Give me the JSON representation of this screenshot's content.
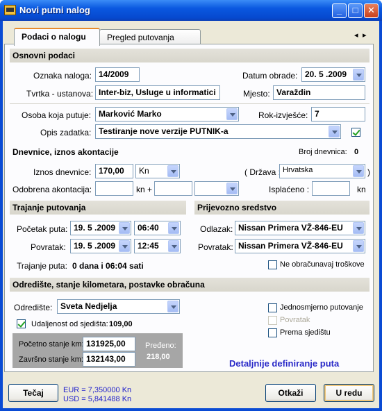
{
  "window": {
    "title": "Novi putni nalog"
  },
  "tabs": [
    {
      "label": "Podaci o nalogu"
    },
    {
      "label": "Pregled putovanja"
    }
  ],
  "tab_scroll": {
    "left": "◂",
    "right": "▸"
  },
  "osnovni": {
    "section": "Osnovni podaci",
    "oznaka_label": "Oznaka naloga:",
    "oznaka_value": "14/2009",
    "datum_label": "Datum obrade:",
    "datum_value": "20. 5 .2009",
    "tvrtka_label": "Tvrtka - ustanova:",
    "tvrtka_value": "Inter-biz, Usluge u informatici",
    "mjesto_label": "Mjesto:",
    "mjesto_value": "Varaždin",
    "osoba_label": "Osoba koja putuje:",
    "osoba_value": "Marković Marko",
    "rok_label": "Rok-izvješće:",
    "rok_value": "7",
    "opis_label": "Opis zadatka:",
    "opis_value": "Testiranje nove verzije PUTNIK-a",
    "opis_checked": true
  },
  "dnevnice": {
    "section": "Dnevnice, iznos akontacije",
    "broj_label": "Broj dnevnica:",
    "broj_value": "0",
    "iznos_label": "Iznos dnevnice:",
    "iznos_value": "170,00",
    "iznos_currency": "Kn",
    "drzava_label": "( Država :",
    "drzava_value": "Hrvatska",
    "drzava_close": ")",
    "akontacija_label": "Odobrena akontacija:",
    "akontacija_value": "",
    "kn_plus": "kn +",
    "akontacija2_value": "",
    "akontacija_currency": "",
    "isplaceno_label": "Isplaćeno :",
    "isplaceno_value": "",
    "isplaceno_unit": "kn"
  },
  "trajanje": {
    "section": "Trajanje putovanja",
    "pocetak_label": "Početak puta:",
    "pocetak_date": "19. 5 .2009",
    "pocetak_time": "06:40",
    "povratak_label": "Povratak:",
    "povratak_date": "19. 5 .2009",
    "povratak_time": "12:45",
    "trajanje_label": "Trajanje puta:",
    "trajanje_value": "0 dana i 06:04 sati"
  },
  "prijevozno": {
    "section": "Prijevozno sredstvo",
    "odlazak_label": "Odlazak:",
    "odlazak_value": "Nissan Primera VŽ-846-EU",
    "povratak_label": "Povratak:",
    "povratak_value": "Nissan Primera VŽ-846-EU",
    "ne_obracunavaj": "Ne obračunavaj troškove"
  },
  "odrediste": {
    "section": "Odredište, stanje kilometara, postavke obračuna",
    "odrediste_label": "Odredište:",
    "odrediste_value": "Sveta Nedjelja",
    "udaljenost_label": "Udaljenost od sjedišta:",
    "udaljenost_value": "109,00",
    "udaljenost_checked": true,
    "jednosmjerno": "Jednosmjerno putovanje",
    "povratak": "Povratak",
    "prema_sjedistu": "Prema sjedištu",
    "pocetno_label": "Početno stanje km:",
    "pocetno_value": "131925,00",
    "zavrsno_label": "Završno stanje km:",
    "zavrsno_value": "132143,00",
    "predeno_label": "Pređeno:",
    "predeno_value": "218,00",
    "detaljnije": "Detaljnije definiranje puta"
  },
  "footer": {
    "tecaj_button": "Tečaj",
    "eur": "EUR = 7,350000 Kn",
    "usd": "USD = 5,841488 Kn",
    "otkazi_button": "Otkaži",
    "ok_button": "U redu"
  },
  "colors": {
    "titlebar": "#0a58e0",
    "section_bg": "#d8d6cc",
    "link": "#2a2ac8",
    "currency_text": "#2222cc"
  }
}
